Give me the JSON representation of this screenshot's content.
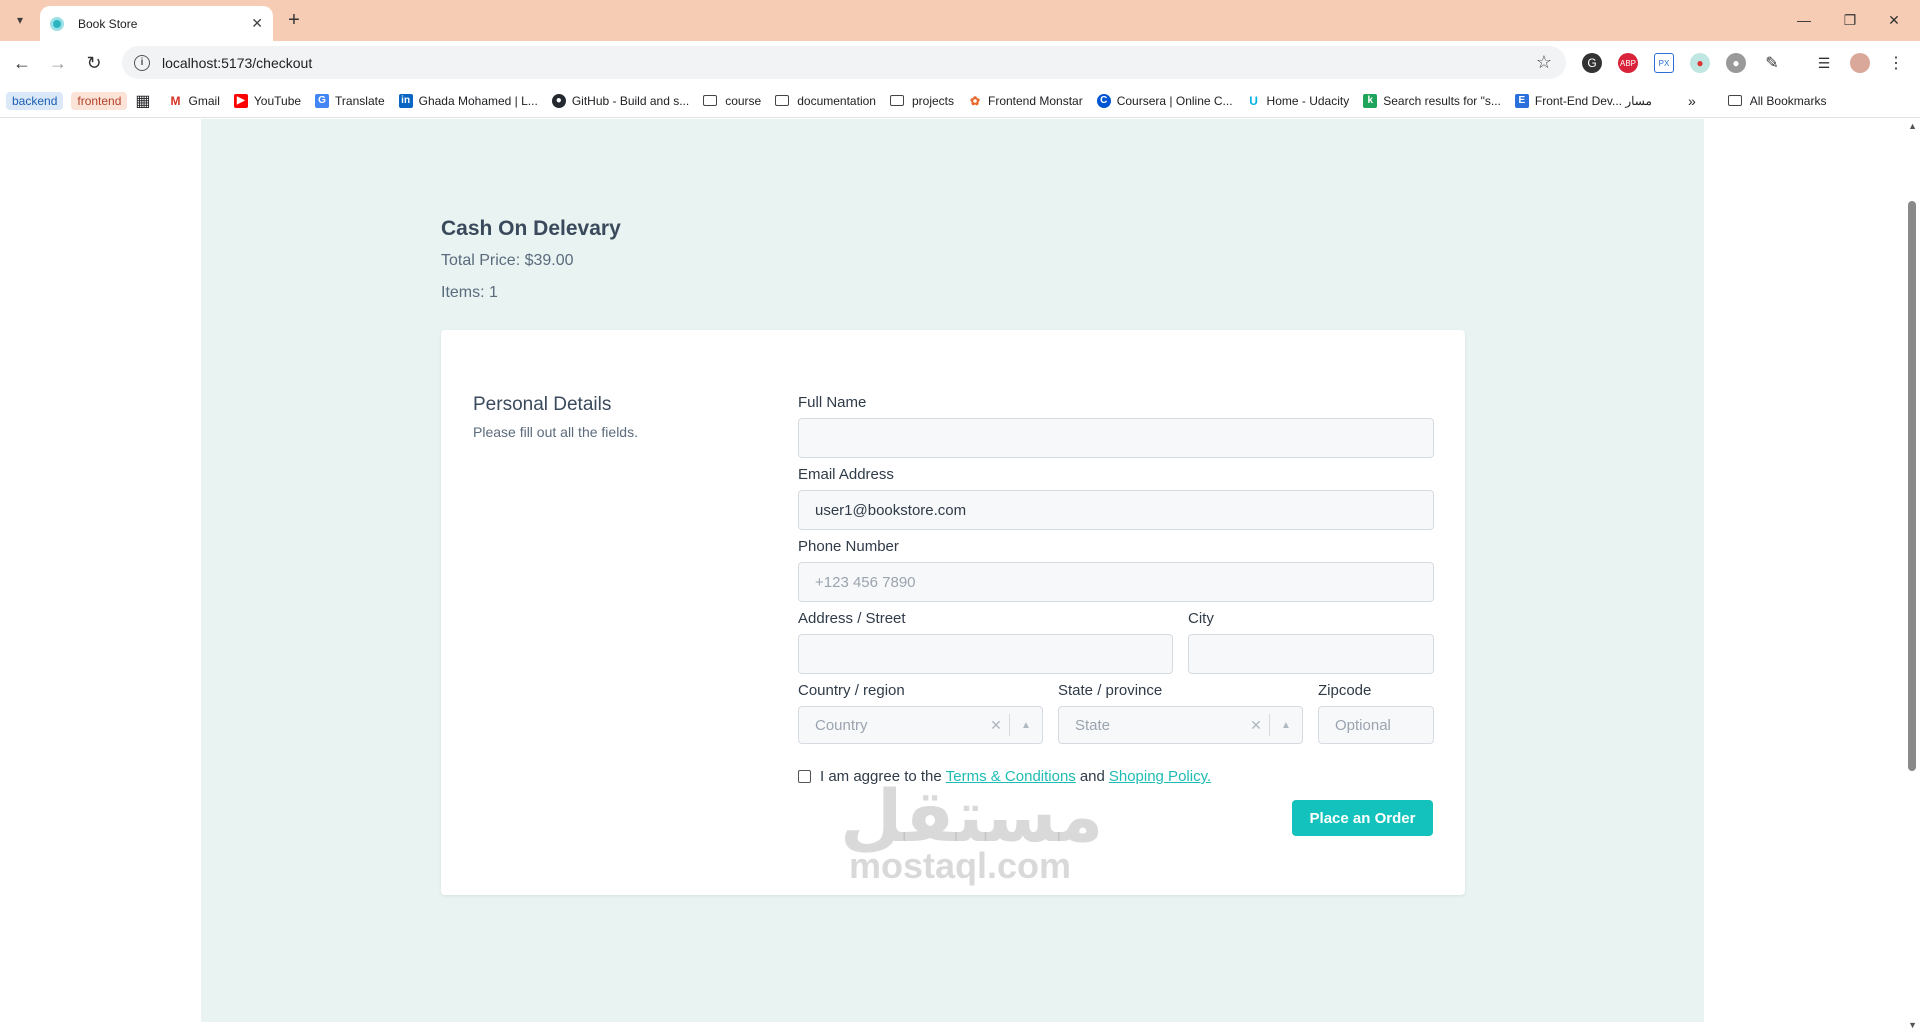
{
  "browser": {
    "tab_title": "Book Store",
    "url": "localhost:5173/checkout",
    "bookmarks": [
      {
        "label": "backend",
        "kind": "pill",
        "bg": "#dbe8f7",
        "color": "#1a5fb4"
      },
      {
        "label": "frontend",
        "kind": "pill",
        "bg": "#fbe3d8",
        "color": "#b3422a"
      },
      {
        "label": "",
        "kind": "apps"
      },
      {
        "label": "Gmail",
        "kind": "icon",
        "icon": "gmail-icon"
      },
      {
        "label": "YouTube",
        "kind": "icon",
        "icon": "youtube-icon"
      },
      {
        "label": "Translate",
        "kind": "icon",
        "icon": "translate-icon"
      },
      {
        "label": "Ghada Mohamed | L...",
        "kind": "icon",
        "icon": "linkedin-icon"
      },
      {
        "label": "GitHub - Build and s...",
        "kind": "icon",
        "icon": "github-icon"
      },
      {
        "label": "course",
        "kind": "folder"
      },
      {
        "label": "documentation",
        "kind": "folder"
      },
      {
        "label": "projects",
        "kind": "folder"
      },
      {
        "label": "Frontend Monstar",
        "kind": "icon",
        "icon": "monstar-icon"
      },
      {
        "label": "Coursera | Online C...",
        "kind": "icon",
        "icon": "coursera-icon"
      },
      {
        "label": "Home - Udacity",
        "kind": "icon",
        "icon": "udacity-icon"
      },
      {
        "label": "Search results for \"s...",
        "kind": "icon",
        "icon": "khamsat-icon"
      },
      {
        "label": "Front-End Dev... مسار",
        "kind": "icon",
        "icon": "edraak-icon"
      }
    ],
    "all_bookmarks": "All Bookmarks"
  },
  "summary": {
    "title": "Cash On Delevary",
    "total": "Total Price: $39.00",
    "items": "Items: 1"
  },
  "form": {
    "section_title": "Personal Details",
    "section_sub": "Please fill out all the fields.",
    "full_name": {
      "label": "Full Name",
      "value": "",
      "placeholder": ""
    },
    "email": {
      "label": "Email Address",
      "value": "user1@bookstore.com",
      "placeholder": ""
    },
    "phone": {
      "label": "Phone Number",
      "value": "",
      "placeholder": "+123 456 7890"
    },
    "address": {
      "label": "Address / Street",
      "value": "",
      "placeholder": ""
    },
    "city": {
      "label": "City",
      "value": "",
      "placeholder": ""
    },
    "country": {
      "label": "Country / region",
      "placeholder": "Country"
    },
    "state": {
      "label": "State / province",
      "placeholder": "State"
    },
    "zipcode": {
      "label": "Zipcode",
      "value": "",
      "placeholder": "Optional"
    },
    "agree_text": "I am aggree to the",
    "terms_link": "Terms & Conditions",
    "and_text": "and",
    "policy_link": "Shoping Policy.",
    "submit_label": "Place an Order"
  },
  "watermark": {
    "arabic": "مستقل",
    "english": "mostaql.com"
  },
  "colors": {
    "accent": "#13c2bc",
    "page_bg": "#e8f3f2",
    "tabbar_bg": "#f7ccb4"
  }
}
